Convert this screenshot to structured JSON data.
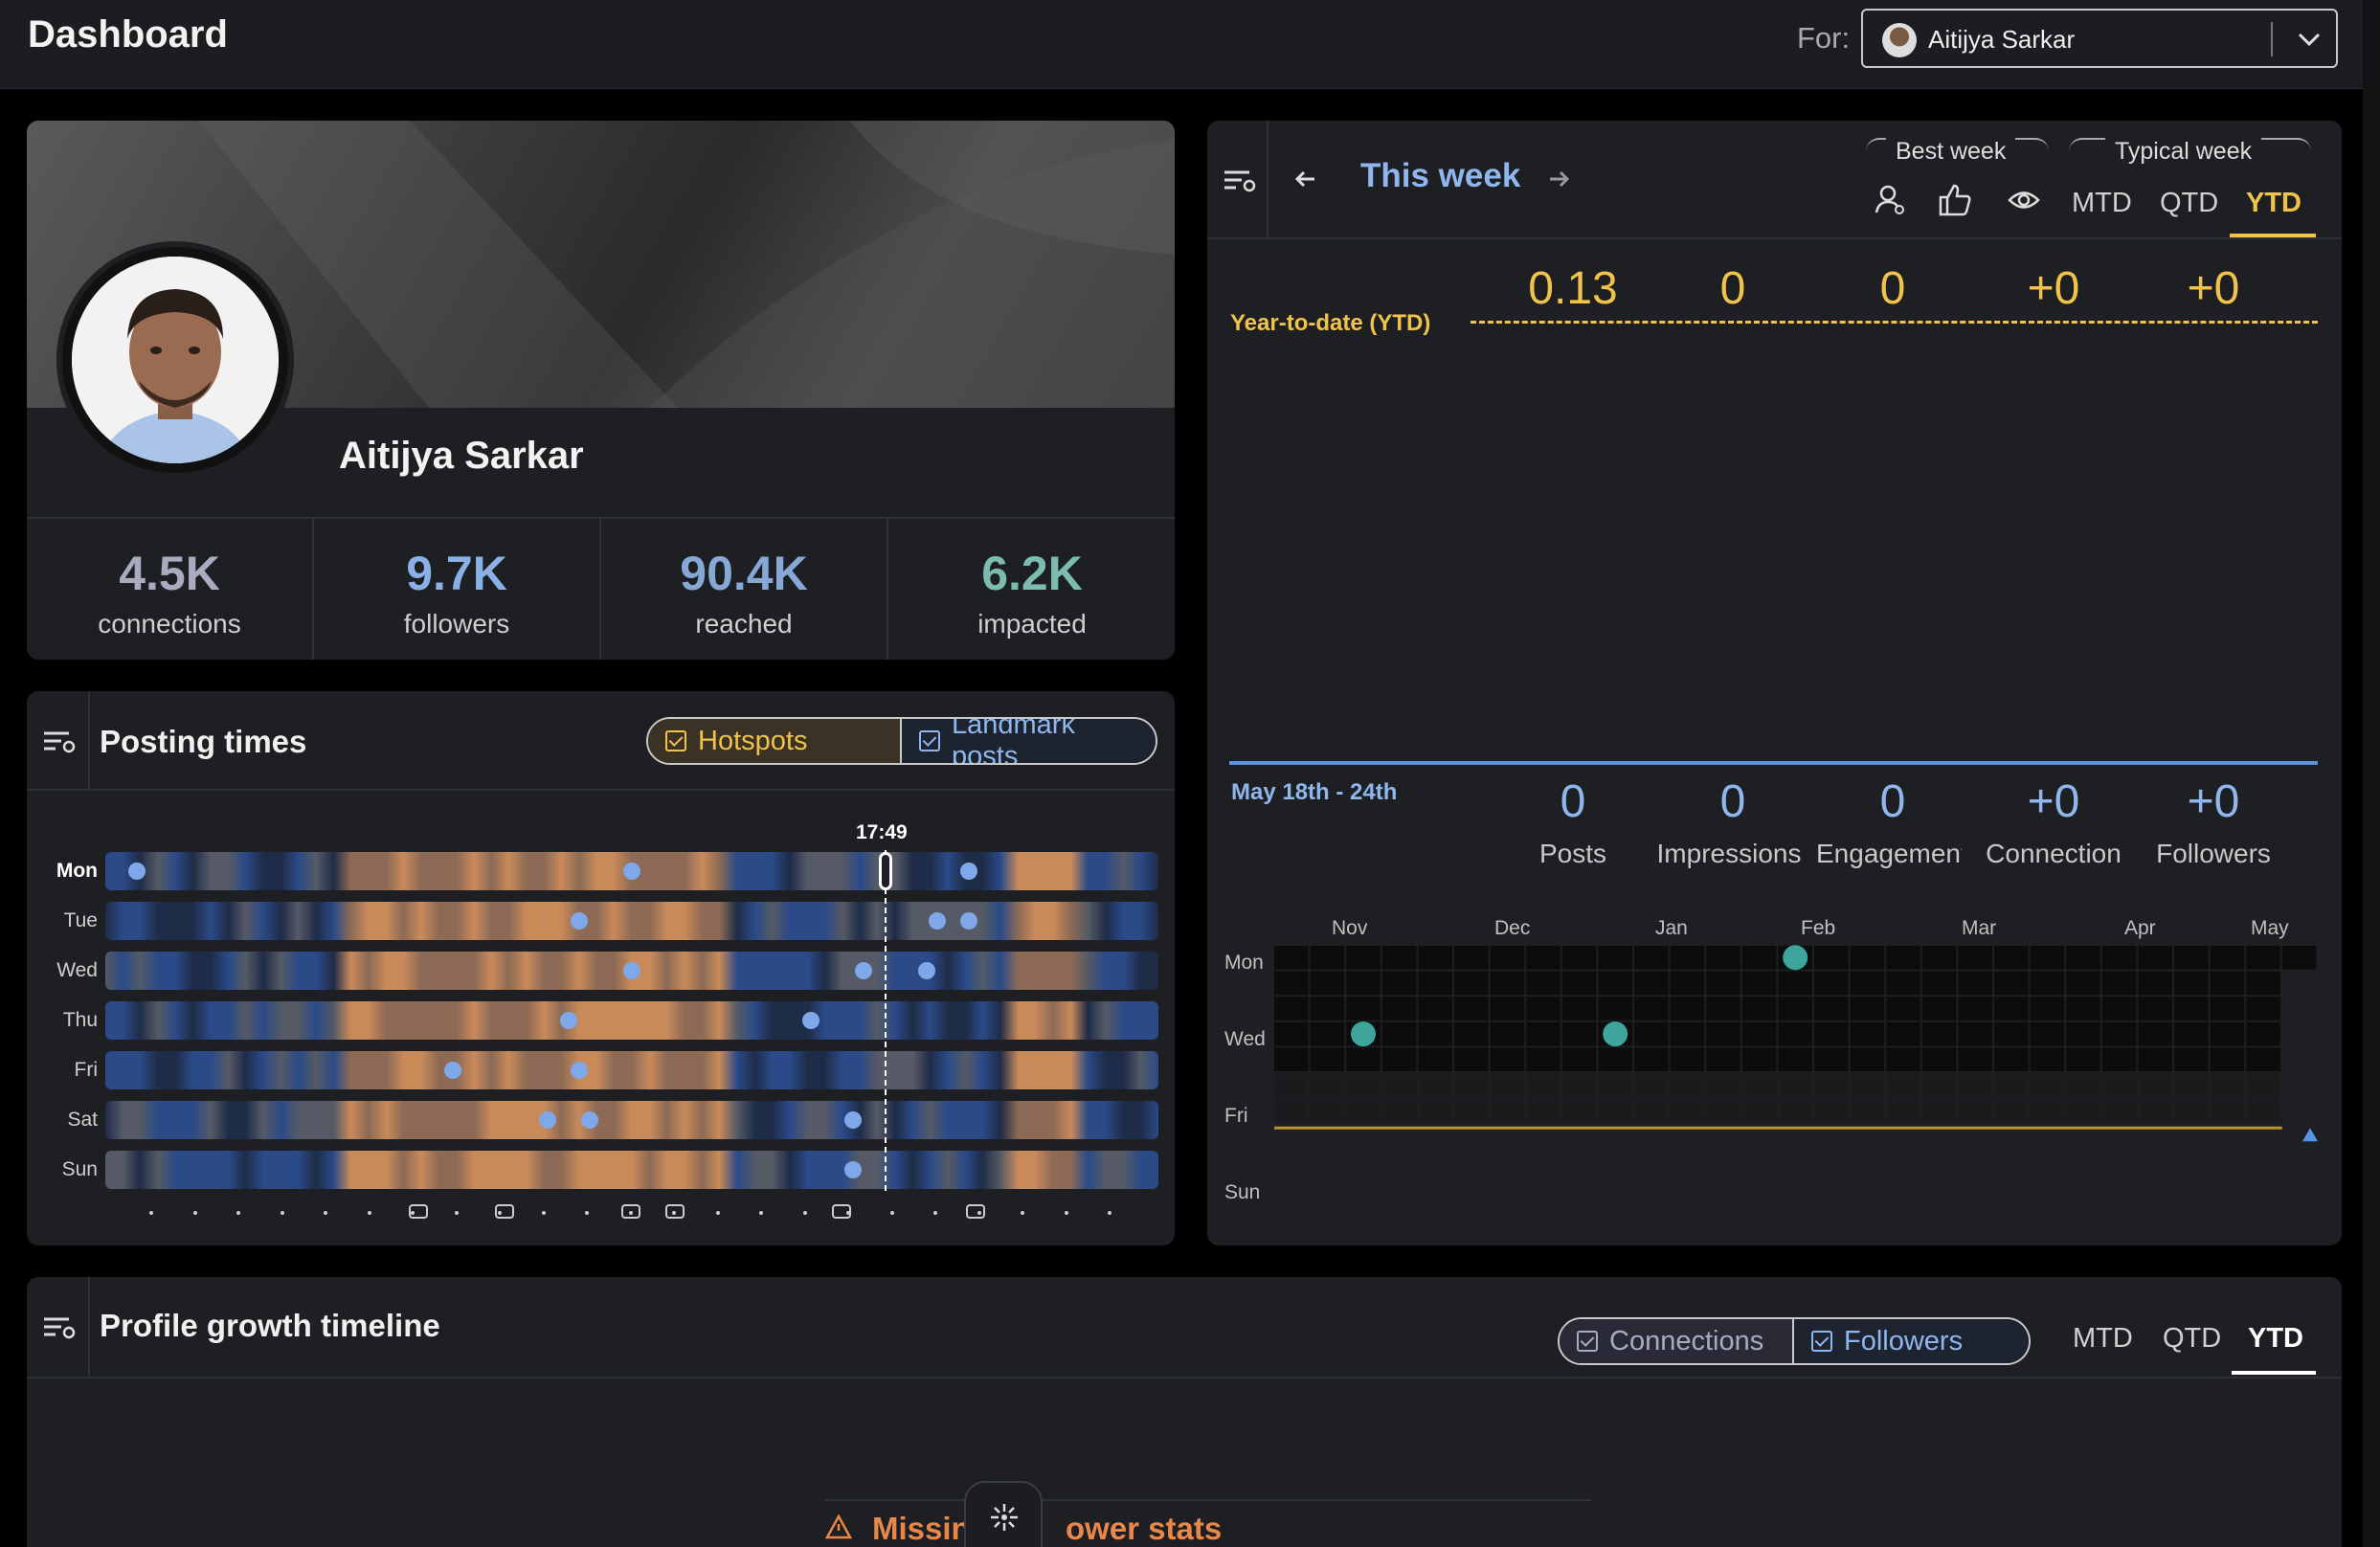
{
  "header": {
    "title": "Dashboard",
    "for_label": "For:",
    "user_name": "Aitijya Sarkar"
  },
  "profile": {
    "name": "Aitijya Sarkar",
    "stats": [
      {
        "value": "4.5K",
        "label": "connections",
        "color": "#a7acc0"
      },
      {
        "value": "9.7K",
        "label": "followers",
        "color": "#8ab0e8"
      },
      {
        "value": "90.4K",
        "label": "reached",
        "color": "#86a8d6"
      },
      {
        "value": "6.2K",
        "label": "impacted",
        "color": "#7cbcb0"
      }
    ]
  },
  "posting_times": {
    "title": "Posting times",
    "toggle_hotspots": "Hotspots",
    "toggle_landmark": "Landmark posts",
    "current_time": "17:49",
    "days": [
      "Mon",
      "Tue",
      "Wed",
      "Thu",
      "Fri",
      "Sat",
      "Sun"
    ],
    "posts_fraction_of_day": [
      [
        0.03,
        0.5,
        0.82
      ],
      [
        0.45,
        0.79,
        0.82
      ],
      [
        0.5,
        0.72,
        0.78
      ],
      [
        0.44,
        0.67
      ],
      [
        0.33,
        0.45
      ],
      [
        0.42,
        0.46,
        0.71
      ],
      [
        0.71
      ]
    ],
    "time_fraction": 0.74,
    "icons": [
      "tv-icon",
      "briefcase-icon",
      "sun-icon",
      "fork-knife-icon",
      "car-icon",
      "sofa-icon"
    ]
  },
  "week": {
    "title": "This week",
    "best_week": "Best week",
    "typical_week": "Typical week",
    "tabs": [
      "MTD",
      "QTD",
      "YTD"
    ],
    "active_tab": "YTD",
    "ytd_label": "Year-to-date (YTD)",
    "ytd_values": [
      "0.13",
      "0",
      "0",
      "+0",
      "+0"
    ],
    "range_label": "May 18th - 24th",
    "week_values": [
      "0",
      "0",
      "0",
      "+0",
      "+0"
    ],
    "week_labels": [
      "Posts",
      "Impressions",
      "Engagement",
      "Connection",
      "Followers"
    ],
    "months": [
      "Nov",
      "Dec",
      "Jan",
      "Feb",
      "Mar",
      "Apr",
      "May"
    ],
    "grid_days": [
      "Mon",
      "Wed",
      "Fri",
      "Sun"
    ],
    "posts_on_grid": [
      {
        "week": 14,
        "day": "Mon"
      },
      {
        "week": 2,
        "day": "Thu"
      },
      {
        "week": 9,
        "day": "Thu"
      }
    ]
  },
  "growth": {
    "title": "Profile growth timeline",
    "toggle_connections": "Connections",
    "toggle_followers": "Followers",
    "tabs": [
      "MTD",
      "QTD",
      "YTD"
    ],
    "active_tab": "YTD",
    "warning_left": "Missin",
    "warning_right": "ower stats"
  },
  "colors": {
    "accent_yellow": "#f2c34a",
    "accent_blue": "#8fb7ee",
    "teal": "#3ea59a"
  }
}
